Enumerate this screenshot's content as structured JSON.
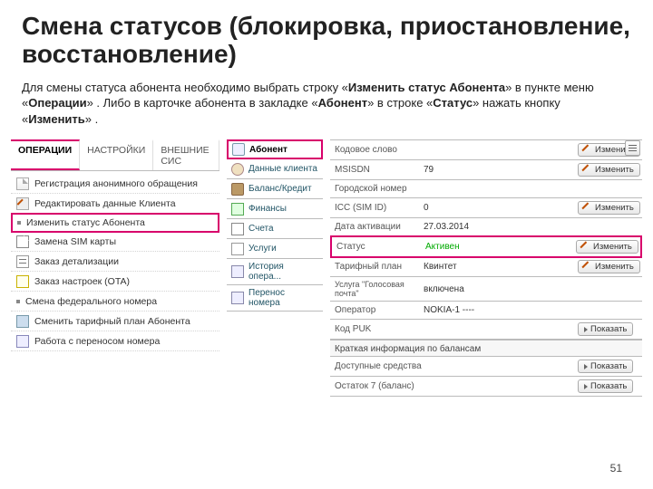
{
  "title": "Смена статусов (блокировка, приостановление, восстановление)",
  "descPre": "Для смены статуса абонента необходимо выбрать строку «",
  "descBold1": "Изменить статус Абонента",
  "descMid": "» в пункте меню «",
  "descBold2": "Операции",
  "descMid2": "» . Либо в карточке абонента в закладке «",
  "descBold3": "Абонент",
  "descMid3": "» в строке «",
  "descBold4": "Статус",
  "descMid4": "» нажать кнопку «",
  "descBold5": "Изменить",
  "descEnd": "» .",
  "menu": {
    "tabs": [
      "ОПЕРАЦИИ",
      "НАСТРОЙКИ",
      "ВНЕШНИЕ СИС"
    ],
    "items": [
      "Регистрация анонимного обращения",
      "Редактировать данные Клиента",
      "Изменить статус Абонента",
      "Замена SIM карты",
      "Заказ детализации",
      "Заказ настроек (OTA)",
      "Смена федерального номера",
      "Сменить тарифный план Абонента",
      "Работа с переносом номера"
    ]
  },
  "side": {
    "items": [
      "Абонент",
      "Данные клиента",
      "Баланс/Кредит",
      "Финансы",
      "Счета",
      "Услуги",
      "История опера...",
      "Перенос номера"
    ]
  },
  "details": {
    "rows": [
      {
        "lab": "Кодовое слово",
        "val": "",
        "btn": "Изменить"
      },
      {
        "lab": "MSISDN",
        "val": "79",
        "btn": "Изменить"
      },
      {
        "lab": "Городской номер",
        "val": "",
        "btn": ""
      },
      {
        "lab": "ICC (SIM ID)",
        "val": "0",
        "btn": "Изменить"
      },
      {
        "lab": "Дата активации",
        "val": "27.03.2014",
        "btn": ""
      }
    ],
    "statusRow": {
      "lab": "Статус",
      "val": "Активен",
      "btn": "Изменить"
    },
    "rows2": [
      {
        "lab": "Тарифный план",
        "val": "Квинтет",
        "btn": "Изменить"
      },
      {
        "lab": "Услуга \"Голосовая почта\"",
        "val": "включена",
        "btn": ""
      },
      {
        "lab": "Оператор",
        "val": "NOKIA-1 ----",
        "btn": ""
      }
    ],
    "puk": {
      "lab": "Код PUK",
      "btn": "Показать"
    },
    "balSection": "Краткая информация по балансам",
    "balRows": [
      {
        "lab": "Доступные средства",
        "btn": "Показать"
      },
      {
        "lab": "Остаток 7 (баланс)",
        "btn": "Показать"
      }
    ]
  },
  "pageNumber": "51"
}
